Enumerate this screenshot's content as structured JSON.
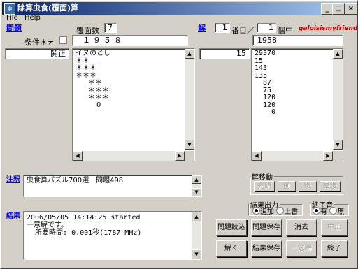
{
  "window": {
    "title": "除算虫食(覆面)算",
    "icon": "app-icon",
    "controls": {
      "minimize": "_",
      "maximize": "□",
      "close": "×"
    }
  },
  "menu": {
    "file": "File",
    "help": "Help"
  },
  "problem": {
    "link": "問題",
    "fukumen_label": "覆面数",
    "fukumen_value": "7",
    "input_value": "１９５８",
    "condition_label": "条件＊≠",
    "condition_checked": false,
    "side_value": "鬨正",
    "body": "イヌのとし\n＊＊\n＊＊＊\n＊＊＊\n   ＊＊\n   ＊＊＊\n   ＊＊＊\n     O"
  },
  "solution": {
    "link": "解",
    "index_value": "1",
    "index_suffix": "番目／",
    "count_value": "1",
    "count_suffix": "個中",
    "author": "galoisismyfriend",
    "value": "1958",
    "side_value": "15",
    "body": "29370\n15\n143\n135\n  87\n  75\n  120\n  120\n    0"
  },
  "note": {
    "link": "注釈",
    "text": "虫食算パズル700選　問題498"
  },
  "result": {
    "link": "結果",
    "lines": "2006/05/05 14:14:25 started\n一意解です。\n  所要時間: 0.001秒(1787 MHz)"
  },
  "navigation": {
    "title": "解移動",
    "first": "先頭",
    "prev": "前",
    "next": "後",
    "last": "最後"
  },
  "output": {
    "title": "結果出力",
    "append": "追加",
    "overwrite": "上書",
    "selected": "append"
  },
  "sound": {
    "title": "終了音",
    "on": "有",
    "off": "無",
    "selected": "on"
  },
  "buttons": {
    "load": "問題読込",
    "save_problem": "問題保存",
    "clear": "消去",
    "stop": "中止",
    "solve": "解く",
    "save_result": "結果保存",
    "unique": "一意解",
    "exit": "終了"
  }
}
